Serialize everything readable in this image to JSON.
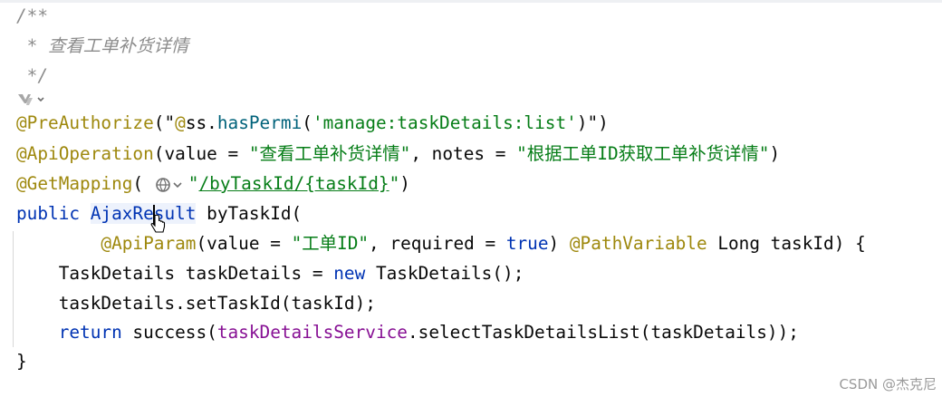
{
  "code": {
    "doc_open": "/**",
    "doc_comment": " * 查看工单补货详情",
    "doc_close": " */",
    "l1": {
      "ann": "@PreAuthorize",
      "p1": "(\"",
      "ann2": "@",
      "obj": "ss",
      "dot": ".",
      "mth": "hasPermi",
      "p2": "(",
      "str": "'manage:taskDetails:list'",
      "p3": ")",
      "p4": "\")"
    },
    "l2": {
      "ann": "@ApiOperation",
      "p1": "(value = ",
      "str1": "\"查看工单补货详情\"",
      "p2": ", notes = ",
      "str2": "\"根据工单ID获取工单补货详情\"",
      "p3": ")"
    },
    "l3": {
      "ann": "@GetMapping",
      "p1": "( ",
      "q": "\"",
      "url": "/byTaskId/{taskId}",
      "q2": "\"",
      "p2": ")"
    },
    "l4": {
      "kw": "public",
      "sp": " ",
      "cls_a": "AjaxRe",
      "cls_b": "sult",
      "rest": " byTaskId("
    },
    "l5": {
      "indent": "        ",
      "ann": "@ApiParam",
      "p1": "(value = ",
      "str": "\"工单ID\"",
      "p2": ", required = ",
      "kw": "true",
      "p3": ") ",
      "ann2": "@PathVariable",
      "p4": " Long taskId) {"
    },
    "l6": {
      "indent": "    ",
      "a": "TaskDetails taskDetails = ",
      "kw": "new",
      "b": " TaskDetails();"
    },
    "l7": {
      "indent": "    ",
      "a": "taskDetails.setTaskId(taskId);"
    },
    "l8": {
      "indent": "    ",
      "kw": "return",
      "a": " success(",
      "fld": "taskDetailsService",
      "b": ".selectTaskDetailsList(taskDetails));"
    },
    "l9": "}"
  },
  "icons": {
    "gutter": "web-endpoint-icon",
    "inlay": "globe-icon",
    "cursor": "hand-pointer-icon"
  },
  "watermark": "CSDN @杰克尼"
}
